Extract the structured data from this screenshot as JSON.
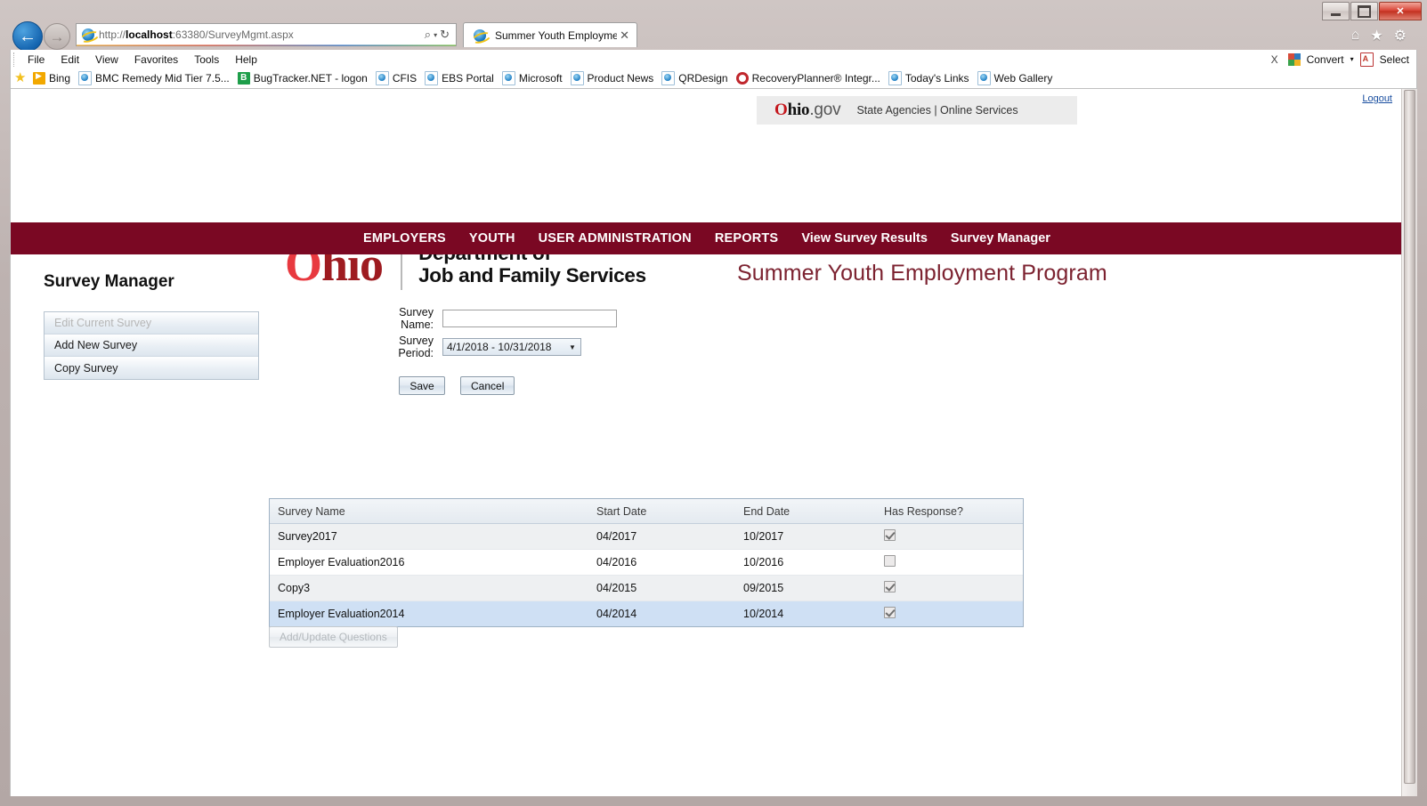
{
  "browser": {
    "window_buttons": {
      "minimize": "─",
      "maximize": "❐",
      "close": "✕"
    },
    "back_glyph": "←",
    "forward_glyph": "→",
    "address": {
      "scheme": "http://",
      "host": "localhost",
      "rest": ":63380/SurveyMgmt.aspx",
      "full": "http://localhost:63380/SurveyMgmt.aspx"
    },
    "address_icons": {
      "search": "⌕",
      "dropdown": "▾",
      "refresh": "↻"
    },
    "tab": {
      "title": "Summer Youth Employme...",
      "close": "✕"
    },
    "top_icons": [
      {
        "name": "home-icon",
        "glyph": "⌂"
      },
      {
        "name": "favorites-star-icon",
        "glyph": "★"
      },
      {
        "name": "tools-gear-icon",
        "glyph": "⚙"
      }
    ],
    "menu": [
      "File",
      "Edit",
      "View",
      "Favorites",
      "Tools",
      "Help"
    ],
    "menu_right": {
      "close_x": "X",
      "convert": "Convert",
      "convert_arrow": "▾",
      "select": "Select"
    },
    "favorites": [
      {
        "label": "Bing",
        "icon": "bing-icon"
      },
      {
        "label": "BMC Remedy Mid Tier 7.5...",
        "icon": "ie-page-icon"
      },
      {
        "label": "BugTracker.NET - logon",
        "icon": "bugtracker-icon"
      },
      {
        "label": "CFIS",
        "icon": "ie-page-icon"
      },
      {
        "label": "EBS Portal",
        "icon": "ie-page-icon"
      },
      {
        "label": "Microsoft",
        "icon": "ie-page-icon"
      },
      {
        "label": "Product News",
        "icon": "ie-page-icon"
      },
      {
        "label": "QRDesign",
        "icon": "ie-page-icon"
      },
      {
        "label": "RecoveryPlanner® Integr...",
        "icon": "recoveryplanner-icon"
      },
      {
        "label": "Today's Links",
        "icon": "ie-page-icon"
      },
      {
        "label": "Web Gallery",
        "icon": "ie-page-icon"
      }
    ]
  },
  "statebar": {
    "logo_o": "O",
    "logo_hio": "hio",
    "logo_gov": ".gov",
    "links": "State Agencies | Online Services",
    "logout": "Logout"
  },
  "brand": {
    "ohio_ring": "O",
    "ohio_rest": "hio",
    "dept_line1": "Department of",
    "dept_line2": "Job and Family Services",
    "program_title": "Summer Youth Employment Program"
  },
  "nav": [
    {
      "label": "EMPLOYERS",
      "style": "caps"
    },
    {
      "label": "YOUTH",
      "style": "caps"
    },
    {
      "label": "USER ADMINISTRATION",
      "style": "caps"
    },
    {
      "label": "REPORTS",
      "style": "caps"
    },
    {
      "label": "View Survey Results",
      "style": "mixed"
    },
    {
      "label": "Survey Manager",
      "style": "mixed"
    }
  ],
  "page": {
    "title": "Survey Manager"
  },
  "sidebar": {
    "items": [
      {
        "label": "Edit Current Survey",
        "disabled": true
      },
      {
        "label": "Add New Survey",
        "disabled": false
      },
      {
        "label": "Copy Survey",
        "disabled": false
      }
    ]
  },
  "form": {
    "survey_name_label": "Survey Name:",
    "survey_name_value": "",
    "survey_name_placeholder": "",
    "survey_period_label": "Survey Period:",
    "survey_period_value": "4/1/2018 - 10/31/2018",
    "survey_period_arrow": "▼",
    "save_label": "Save",
    "cancel_label": "Cancel"
  },
  "grid": {
    "columns": [
      "Survey Name",
      "Start Date",
      "End Date",
      "Has Response?"
    ],
    "rows": [
      {
        "name": "Survey2017",
        "start": "04/2017",
        "end": "10/2017",
        "has_response": true
      },
      {
        "name": "Employer Evaluation2016",
        "start": "04/2016",
        "end": "10/2016",
        "has_response": false
      },
      {
        "name": "Copy3",
        "start": "04/2015",
        "end": "09/2015",
        "has_response": true
      },
      {
        "name": "Employer Evaluation2014",
        "start": "04/2014",
        "end": "10/2014",
        "has_response": true
      }
    ],
    "selected_row_index": 3
  },
  "actions": {
    "add_update_questions": "Add/Update Questions"
  },
  "colors": {
    "nav_maroon": "#7a0823",
    "program_title": "#7c2230",
    "ohio_red": "#9e1b20",
    "ohio_ring_red": "#e8393f",
    "selected_row": "#cfe0f4",
    "link_blue": "#1a4fa0"
  }
}
